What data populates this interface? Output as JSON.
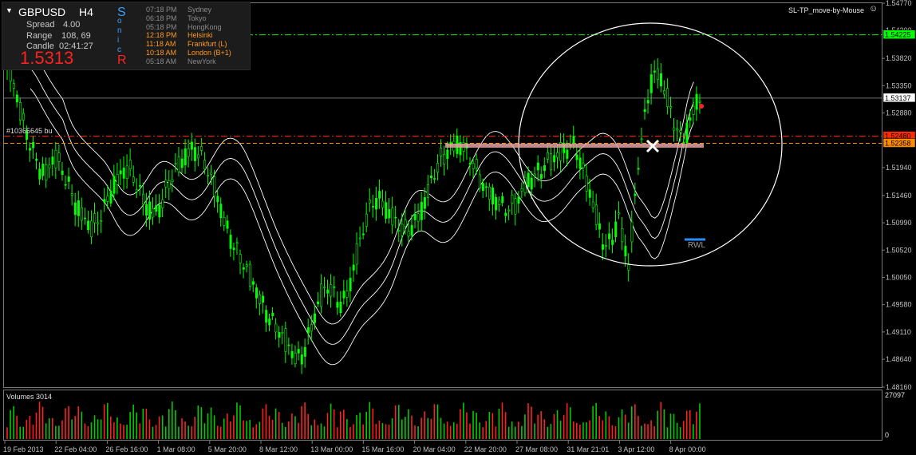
{
  "symbol": "GBPUSD",
  "timeframe": "H4",
  "info": {
    "spread_label": "Spread",
    "spread_value": "4.00",
    "range_label": "Range",
    "range_value": "108, 69",
    "candle_label": "Candle",
    "candle_value": "02:41:27",
    "price": "1.5313"
  },
  "session_letters": [
    "S",
    "o",
    "n",
    "i",
    "c",
    "R"
  ],
  "sessions": [
    {
      "time": "07:18 PM",
      "city": "Sydney",
      "color": "#8a8a8a"
    },
    {
      "time": "06:18 PM",
      "city": "Tokyo",
      "color": "#8a8a8a"
    },
    {
      "time": "05:18 PM",
      "city": "HongKong",
      "color": "#8a8a8a"
    },
    {
      "time": "12:18 PM",
      "city": "Helsinki",
      "color": "#ff9a1a"
    },
    {
      "time": "11:18 AM",
      "city": "Frankfurt  (L)",
      "color": "#ff9a1a"
    },
    {
      "time": "10:18 AM",
      "city": "London  (B+1)",
      "color": "#ff9a1a"
    },
    {
      "time": "05:18 AM",
      "city": "NewYork",
      "color": "#8a8a8a"
    }
  ],
  "ea_label": "SL-TP_move-by-Mouse",
  "order_label": "#10365645 bu",
  "rwl_label": "RWL",
  "volumes_label": "Volumes 3014",
  "volume_scale": {
    "top": "27097",
    "bottom": "0"
  },
  "price_labels": [
    "1.54770",
    "1.54300",
    "1.53820",
    "1.53350",
    "1.52880",
    "1.52410",
    "1.51940",
    "1.51460",
    "1.50990",
    "1.50520",
    "1.50050",
    "1.49580",
    "1.49110",
    "1.48640",
    "1.48160"
  ],
  "price_tags": [
    {
      "value": "1.54225",
      "bg": "#00ff00",
      "fg": "#000000"
    },
    {
      "value": "1.53137",
      "bg": "#ffffff",
      "fg": "#000000"
    },
    {
      "value": "1.52480",
      "bg": "#ff2a00",
      "fg": "#000000"
    },
    {
      "value": "1.52358",
      "bg": "#ff8c00",
      "fg": "#000000"
    }
  ],
  "time_labels": [
    "19 Feb 2013",
    "22 Feb 04:00",
    "26 Feb 16:00",
    "1 Mar 08:00",
    "5 Mar 20:00",
    "8 Mar 12:00",
    "13 Mar 00:00",
    "15 Mar 16:00",
    "20 Mar 04:00",
    "22 Mar 20:00",
    "27 Mar 08:00",
    "31 Mar 21:01",
    "3 Apr 12:00",
    "8 Apr 00:00"
  ],
  "colors": {
    "bull": "#00ff00",
    "bear": "#00ff00",
    "grid": "#1e1e1e",
    "volume_up": "#00cc00",
    "volume_down": "#ff2020",
    "axis_text": "#c0c0c0"
  },
  "chart_data": {
    "type": "candlestick",
    "symbol": "GBPUSD",
    "timeframe": "H4",
    "ylim": [
      1.4816,
      1.5477
    ],
    "bid": 1.53137,
    "levels": [
      {
        "value": 1.54225,
        "color": "#00ff00",
        "style": "dash-dot"
      },
      {
        "value": 1.53137,
        "color": "#c0c0c0",
        "style": "solid"
      },
      {
        "value": 1.5248,
        "color": "#ff2a00",
        "style": "dash-dot"
      },
      {
        "value": 1.52358,
        "color": "#ff8c00",
        "style": "dashed"
      }
    ],
    "close_path": [
      1.5365,
      1.5345,
      1.531,
      1.528,
      1.5255,
      1.5235,
      1.5215,
      1.5195,
      1.518,
      1.5195,
      1.521,
      1.5195,
      1.518,
      1.5165,
      1.5145,
      1.5125,
      1.511,
      1.5095,
      1.5085,
      1.5095,
      1.5115,
      1.514,
      1.516,
      1.5175,
      1.5185,
      1.519,
      1.518,
      1.5165,
      1.515,
      1.5135,
      1.5125,
      1.512,
      1.5125,
      1.514,
      1.516,
      1.518,
      1.5195,
      1.521,
      1.5225,
      1.523,
      1.5225,
      1.521,
      1.519,
      1.517,
      1.515,
      1.5125,
      1.51,
      1.508,
      1.506,
      1.504,
      1.502,
      1.5005,
      1.499,
      1.4975,
      1.496,
      1.4945,
      1.493,
      1.4915,
      1.49,
      1.4885,
      1.4875,
      1.4865,
      1.4875,
      1.4895,
      1.492,
      1.4945,
      1.4965,
      1.498,
      1.4985,
      1.4975,
      1.4965,
      1.497,
      1.499,
      1.502,
      1.505,
      1.508,
      1.511,
      1.5135,
      1.5145,
      1.514,
      1.5125,
      1.511,
      1.5095,
      1.5085,
      1.508,
      1.509,
      1.5105,
      1.512,
      1.514,
      1.516,
      1.518,
      1.5195,
      1.521,
      1.5225,
      1.5235,
      1.524,
      1.5235,
      1.522,
      1.52,
      1.518,
      1.5165,
      1.5155,
      1.515,
      1.5145,
      1.5135,
      1.5125,
      1.512,
      1.5125,
      1.514,
      1.516,
      1.5175,
      1.5185,
      1.519,
      1.5195,
      1.52,
      1.5205,
      1.521,
      1.522,
      1.523,
      1.524,
      1.523,
      1.52,
      1.517,
      1.514,
      1.511,
      1.508,
      1.506,
      1.507,
      1.509,
      1.511,
      1.506,
      1.502,
      1.51,
      1.52,
      1.526,
      1.532,
      1.5355,
      1.536,
      1.534,
      1.531,
      1.528,
      1.526,
      1.5245,
      1.5255,
      1.528,
      1.5305,
      1.5313
    ],
    "volume_range": [
      0,
      27097
    ]
  }
}
